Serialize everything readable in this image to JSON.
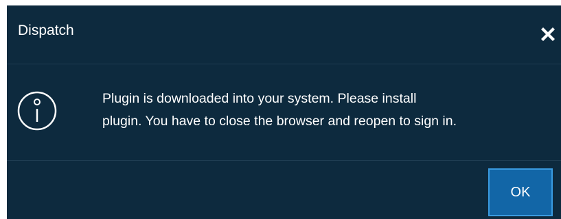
{
  "dialog": {
    "title": "Dispatch",
    "close_icon": "close-icon",
    "info_icon": "info-icon",
    "message_lines": [
      "Plugin is downloaded into your system. Please install",
      "plugin. You have to close the browser and reopen to sign in."
    ],
    "ok_label": "OK"
  },
  "colors": {
    "background": "#0d2a3e",
    "divider": "#1f3d52",
    "text": "#ffffff",
    "ok_button": "#1266a7",
    "ok_button_border": "#3a9be0"
  }
}
